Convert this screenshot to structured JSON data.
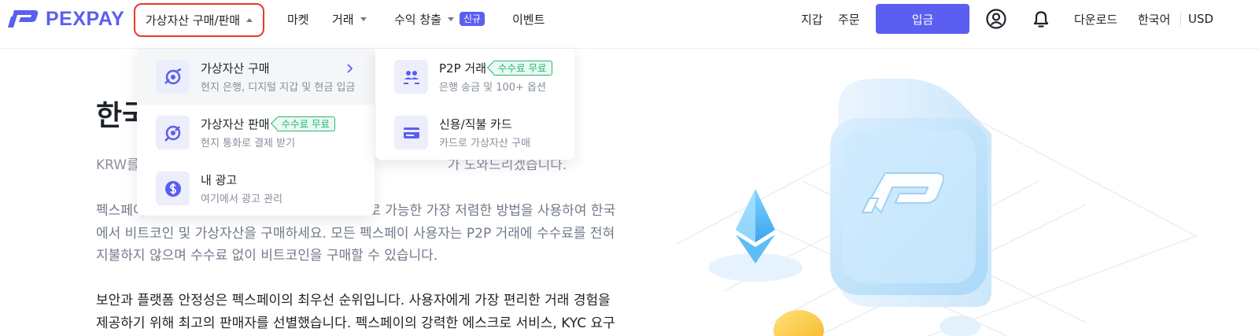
{
  "brand": {
    "name": "PEXPAY",
    "color": "#5b5ef0"
  },
  "nav": {
    "buy_sell": "가상자산 구매/판매",
    "market": "마켓",
    "trade": "거래",
    "earn": "수익 창출",
    "earn_badge": "신규",
    "events": "이벤트"
  },
  "header_right": {
    "wallet": "지갑",
    "orders": "주문",
    "deposit": "입금",
    "download": "다운로드",
    "language": "한국어",
    "currency": "USD",
    "icons": [
      "user-icon",
      "bell-icon"
    ]
  },
  "dropdown": {
    "left": [
      {
        "title": "가상자산 구매",
        "subtitle": "현지 은행, 디지털 지갑 및 현금 입금",
        "icon": "buy-crypto-icon",
        "has_arrow": true
      },
      {
        "title": "가상자산 판매",
        "tag": "수수료 무료",
        "subtitle": "현지 통화로 결제 받기",
        "icon": "sell-crypto-icon"
      },
      {
        "title": "내 광고",
        "subtitle": "여기에서 광고 관리",
        "icon": "dollar-icon"
      }
    ],
    "right": [
      {
        "title": "P2P 거래",
        "tag": "수수료 무료",
        "subtitle": "은행 송금 및 100+ 옵션",
        "icon": "p2p-users-icon"
      },
      {
        "title": "신용/직불 카드",
        "subtitle": "카드로 가상자산 구매",
        "icon": "credit-card-icon"
      }
    ]
  },
  "hero": {
    "title_visible": "한국",
    "p1_left": "KRW를",
    "p1_right": "가 도와드리겠습니다.",
    "p2_line1_left": "펙스페이",
    "p2_line1_right": "으로 가능한 가장 저렴한 방법을 사용하여 한국",
    "p2_line2": "에서 비트코인 및 가상자산을 구매하세요. 모든 펙스페이 사용자는 P2P 거래에 수수료를 전혀",
    "p2_line3": "지불하지 않으며 수수료 없이 비트코인을 구매할 수 있습니다.",
    "p3_line1": "보안과 플랫폼 안정성은 펙스페이의 최우선 순위입니다. 사용자에게 가장 편리한 거래 경험을",
    "p3_line2": "제공하기 위해 최고의 판매자를 선별했습니다. 펙스페이의 강력한 에스크로 서비스, KYC 요구"
  },
  "colors": {
    "accent": "#5b5ef0",
    "free_tag": "#2bb673",
    "highlight_border": "#e8382f"
  }
}
